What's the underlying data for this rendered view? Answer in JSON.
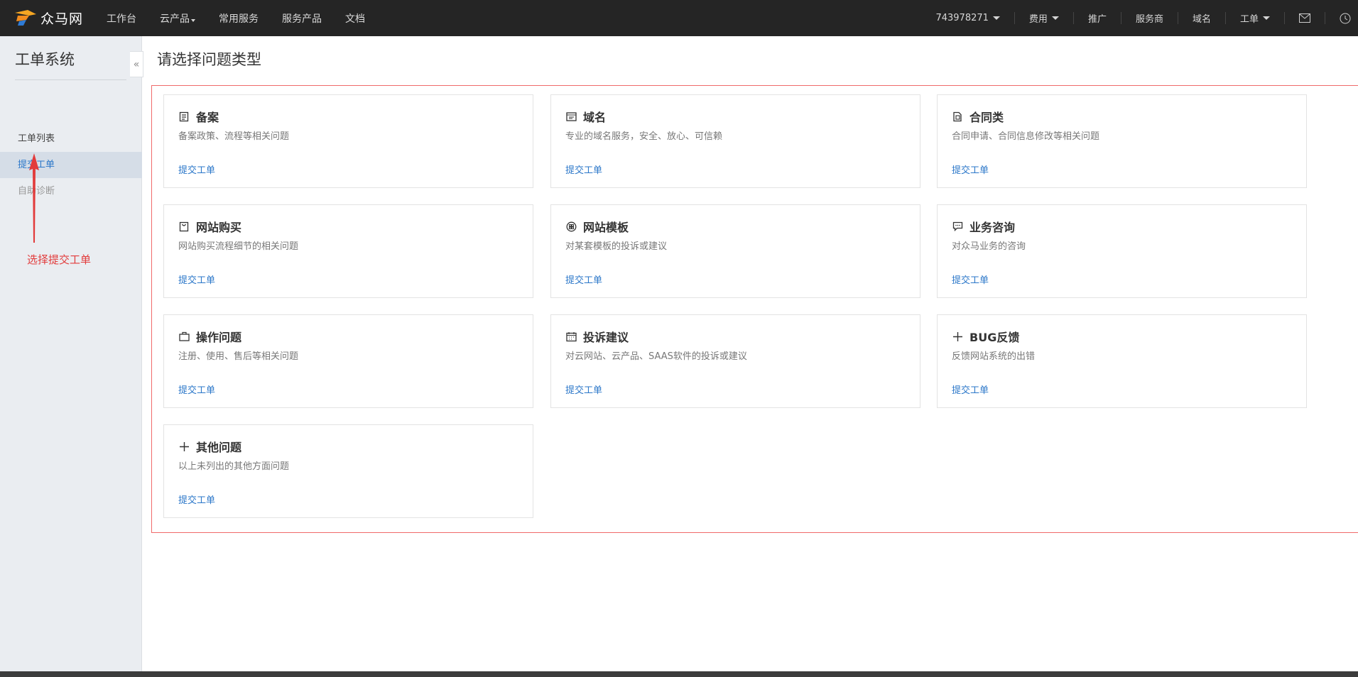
{
  "topbar": {
    "logo_text": "众马网",
    "nav_left": [
      "工作台",
      "云产品",
      "常用服务",
      "服务产品",
      "文档"
    ],
    "account_id": "743978271",
    "nav_right": [
      "费用",
      "推广",
      "服务商",
      "域名",
      "工单"
    ]
  },
  "sidebar": {
    "title": "工单系统",
    "items": [
      {
        "label": "工单列表"
      },
      {
        "label": "提交工单"
      },
      {
        "label": "自助诊断"
      }
    ],
    "collapse_glyph": "«"
  },
  "annotation": {
    "text": "选择提交工单",
    "color": "#e23b3b"
  },
  "main": {
    "title": "请选择问题类型",
    "link_label": "提交工单",
    "cards": [
      {
        "title": "备案",
        "desc": "备案政策、流程等相关问题",
        "icon": "document-icon"
      },
      {
        "title": "域名",
        "desc": "专业的域名服务，安全、放心、可信赖",
        "icon": "browser-window-icon"
      },
      {
        "title": "合同类",
        "desc": "合同申请、合同信息修改等相关问题",
        "icon": "contract-icon"
      },
      {
        "title": "网站购买",
        "desc": "网站购买流程细节的相关问题",
        "icon": "shopping-bag-icon"
      },
      {
        "title": "网站模板",
        "desc": "对某套模板的投诉或建议",
        "icon": "template-grid-icon"
      },
      {
        "title": "业务咨询",
        "desc": "对众马业务的咨询",
        "icon": "chat-bubble-icon"
      },
      {
        "title": "操作问题",
        "desc": "注册、使用、售后等相关问题",
        "icon": "briefcase-icon"
      },
      {
        "title": "投诉建议",
        "desc": "对云网站、云产品、SAAS软件的投诉或建议",
        "icon": "calendar-icon"
      },
      {
        "title": "BUG反馈",
        "desc": "反馈网站系统的出错",
        "icon": "plus-icon"
      },
      {
        "title": "其他问题",
        "desc": "以上未列出的其他方面问题",
        "icon": "plus-icon"
      }
    ]
  },
  "colors": {
    "topbar_bg": "#252525",
    "sidebar_bg": "#eaedf1",
    "link": "#2b77c9",
    "highlight_border": "#f06a6a"
  }
}
